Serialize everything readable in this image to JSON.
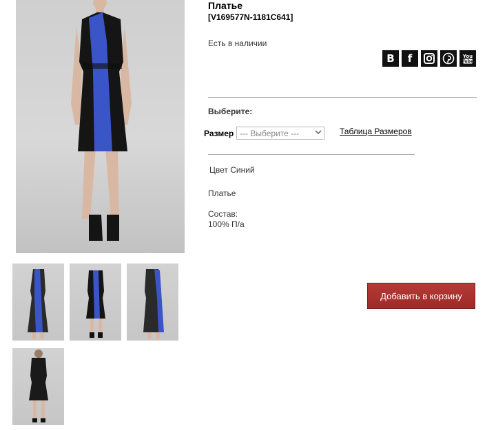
{
  "product": {
    "title": "Платье",
    "sku": "[V169577N-1181C641]",
    "stock_status": "Есть в наличии",
    "description": "Платье",
    "color_text": "Цвет Синий",
    "composition_label": "Состав:",
    "composition_value": "100% П/а"
  },
  "options": {
    "choose_label": "Выберите:",
    "size_label": "Размер",
    "size_select_value": "--- Выберите ---",
    "size_table_link": "Таблица Размеров"
  },
  "social": [
    {
      "icon": "vk-icon",
      "glyph": "B"
    },
    {
      "icon": "facebook-icon",
      "glyph": "f"
    },
    {
      "icon": "instagram-icon",
      "glyph": ""
    },
    {
      "icon": "pinterest-icon",
      "glyph": ""
    },
    {
      "icon": "youtube-icon",
      "glyph": ""
    }
  ],
  "cart": {
    "button_label": "Добавить в корзину"
  },
  "colors": {
    "accent_blue": "#3a55c8",
    "dress_black": "#151515",
    "cart_red": "#a8302d"
  }
}
